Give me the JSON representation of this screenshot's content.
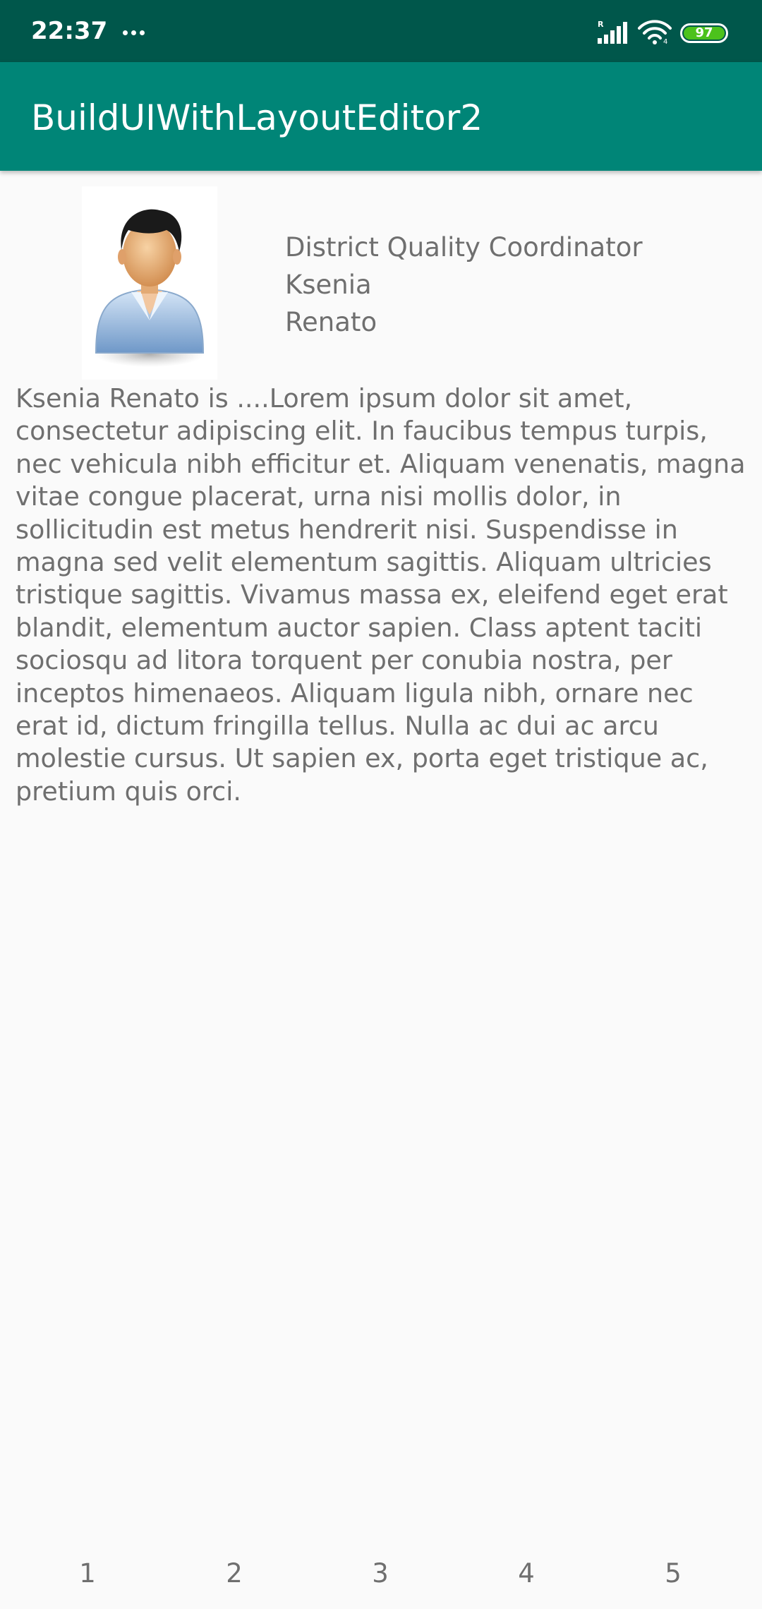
{
  "status_bar": {
    "time": "22:37",
    "battery_level": "97",
    "icons": [
      "more-dots-icon",
      "signal-icon",
      "wifi-icon",
      "battery-icon"
    ],
    "colors": {
      "background": "#00574b",
      "battery": "#4cc21c"
    }
  },
  "app_bar": {
    "title": "BuildUIWithLayoutEditor2",
    "color": "#008577"
  },
  "profile": {
    "avatar_icon": "person-avatar-icon",
    "job_title": "District Quality Coordinator",
    "first_name": "Ksenia",
    "last_name": "Renato",
    "bio": "Ksenia Renato is ....Lorem ipsum dolor sit amet, consectetur adipiscing elit. In faucibus tempus turpis, nec vehicula nibh efficitur et. Aliquam venenatis, magna vitae congue placerat, urna nisi mollis dolor, in sollicitudin est metus hendrerit nisi. Suspendisse in magna sed velit elementum sagittis. Aliquam ultricies tristique sagittis. Vivamus massa ex, eleifend eget erat blandit, elementum auctor sapien. Class aptent taciti sociosqu ad litora torquent per conubia nostra, per inceptos himenaeos. Aliquam ligula nibh, ornare nec erat id, dictum fringilla tellus. Nulla ac dui ac arcu molestie cursus. Ut sapien ex, porta eget tristique ac, pretium quis orci."
  },
  "bottom_items": [
    "1",
    "2",
    "3",
    "4",
    "5"
  ]
}
